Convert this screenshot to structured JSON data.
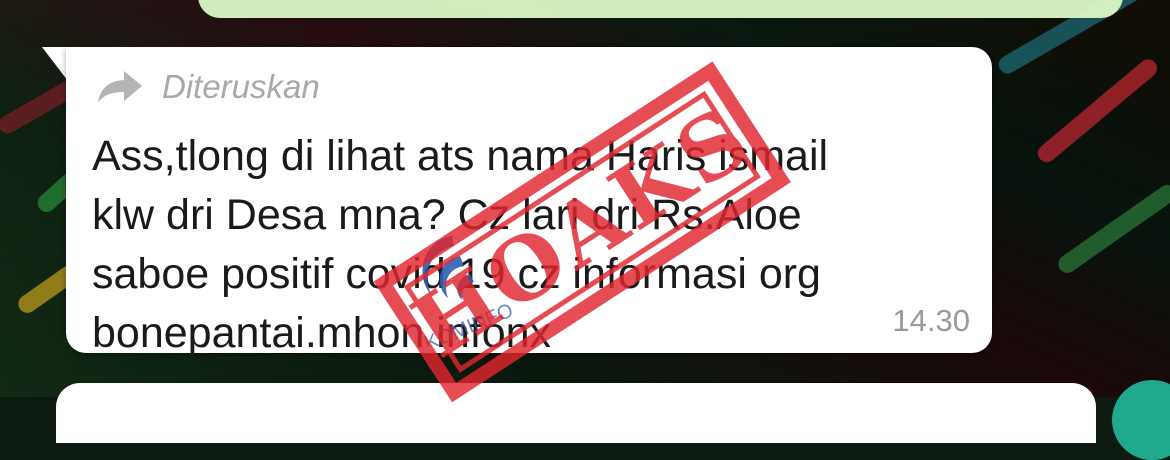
{
  "message": {
    "forward_label": "Diteruskan",
    "lines": [
      "Ass,tlong di lihat ats nama Haris ismail",
      "klw dri Desa mna? Cz lari dri Rs.Aloe",
      "saboe positif covid 19 cz informasi org",
      "bonepantai.mhon infonx"
    ],
    "time": "14.30"
  },
  "stamp": {
    "label": "HOAKS",
    "color": "#e0262e"
  },
  "watermark": {
    "label": "KOMINFO"
  },
  "colors": {
    "bubble_incoming": "#ffffff",
    "bubble_outgoing": "#dcf8c6",
    "fab": "#1faa8e"
  }
}
